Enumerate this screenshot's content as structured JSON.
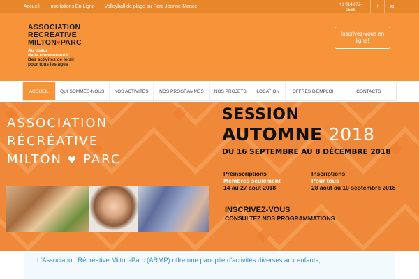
{
  "topbar": {
    "links": [
      "Accueil",
      "Inscriptions En Ligne",
      "Volleyball de plage au Parc Jeanne-Mance"
    ],
    "phone": "+1 514 872-0566",
    "social_icons": [
      "facebook-icon",
      "email-icon"
    ]
  },
  "header": {
    "logo_line1": "Association",
    "logo_line2": "Récréative",
    "logo_line3a": "Milton",
    "logo_line3b": "Parc",
    "tag1": "Au coeur",
    "tag2": "de la communauté",
    "tag3": "Des activités de loisir",
    "tag4": "pour tous les âges",
    "cta": "Inscrivez-vous en ligne!"
  },
  "nav": {
    "items": [
      "ACCUEIL",
      "QUI SOMMES-NOUS",
      "NOS ACTIVITÉS",
      "NOS PROGRAMMES",
      "NOS PROJETS",
      "LOCATION",
      "OFFRES D'EMPLOI",
      "CONTACTS"
    ],
    "active_index": 0
  },
  "banner": {
    "title1": "Association",
    "title2": "Récréative",
    "title3a": "Milton",
    "title3b": "Parc",
    "session1": "SESSION",
    "session2": "AUTOMNE",
    "session_year": "2018",
    "dates": "DU 16 SEPTEMBRE AU 8 DÉCEMBRE 2018",
    "pre_label": "Préinscriptions",
    "pre_sub": "Membres seulement",
    "pre_dates": "14 au 27 août 2018",
    "ins_label": "Inscriptions",
    "ins_sub": "Pour tous",
    "ins_dates": "28 août au 10 septembre 2018",
    "cta1": "INSCRIVEZ-VOUS",
    "cta2": "CONSULTEZ NOS PROGRAMMATIONS"
  },
  "intro": {
    "text": "L'Association Récréative Milton-Parc (ARMP) offre  une panoplie d'activités diverses aux enfants,"
  },
  "colors": {
    "orange_top": "#e8872a",
    "orange": "#f7943a",
    "heart": "#e2363b",
    "link_blue": "#3a8dbf"
  }
}
